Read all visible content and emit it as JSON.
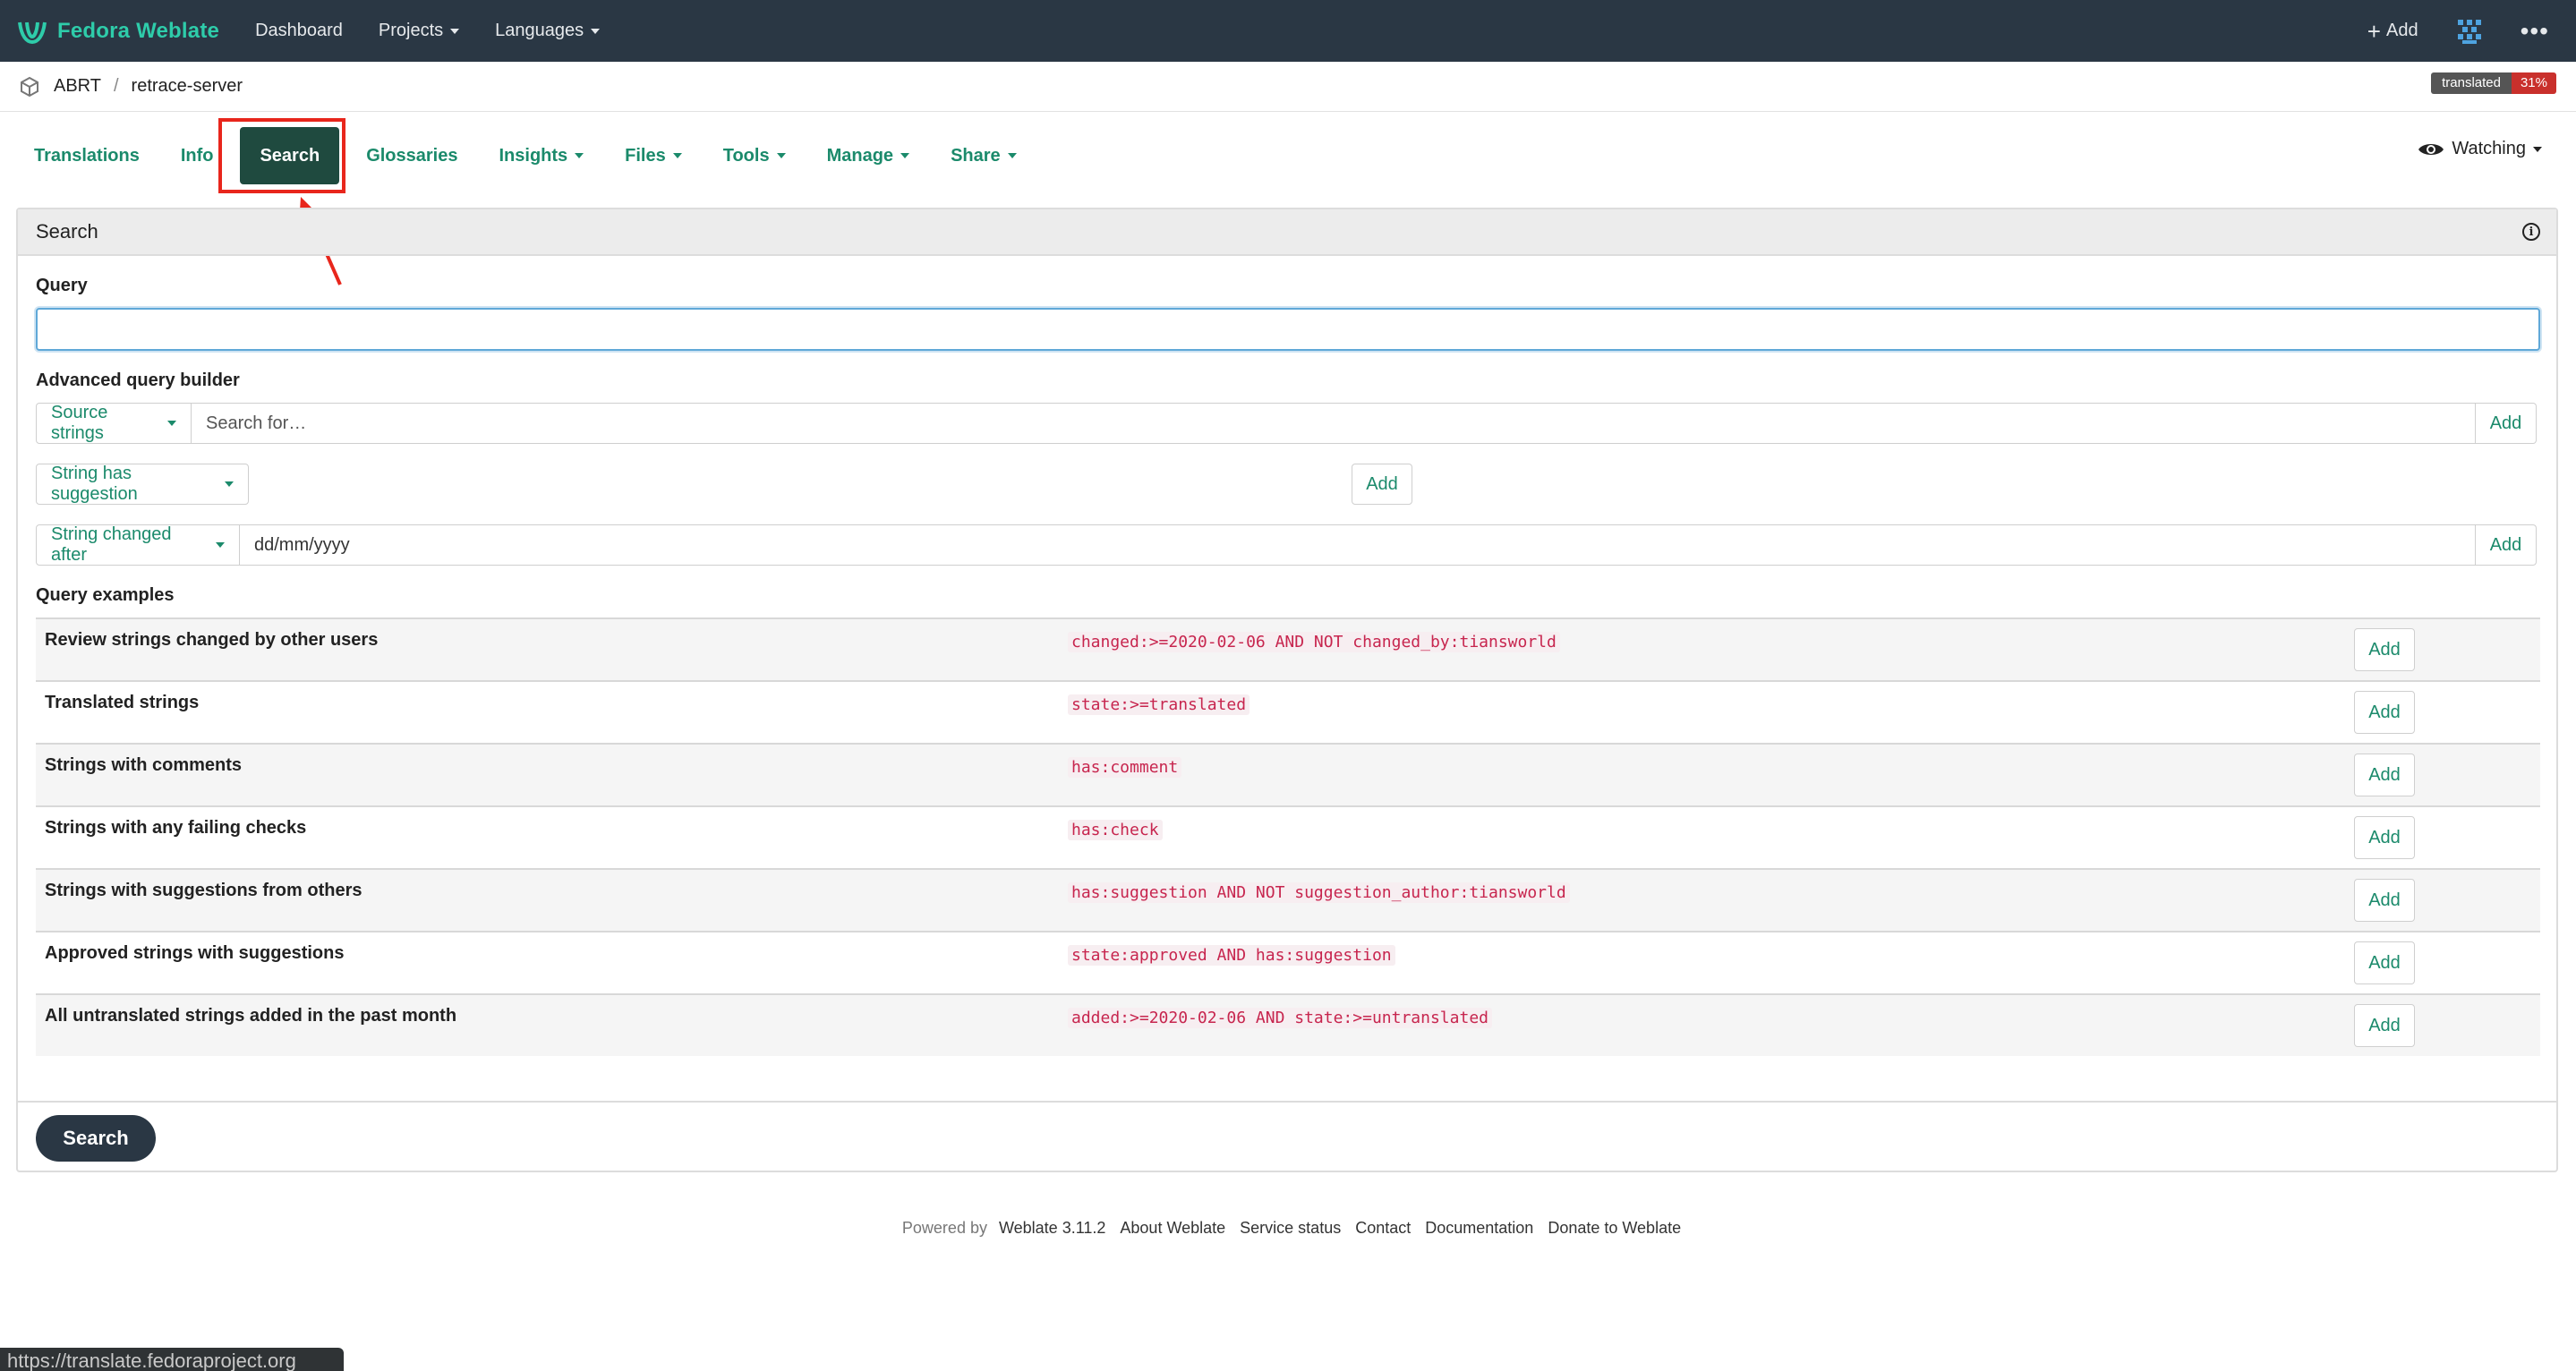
{
  "nav": {
    "brand": "Fedora Weblate",
    "items": [
      "Dashboard",
      "Projects",
      "Languages"
    ],
    "add_label": "Add"
  },
  "breadcrumb": {
    "project": "ABRT",
    "separator": "/",
    "component": "retrace-server",
    "badge_label": "translated",
    "badge_value": "31%"
  },
  "tabs": {
    "translations": "Translations",
    "info": "Info",
    "search": "Search",
    "glossaries": "Glossaries",
    "insights": "Insights",
    "files": "Files",
    "tools": "Tools",
    "manage": "Manage",
    "share": "Share"
  },
  "watching": "Watching",
  "panel": {
    "title": "Search",
    "query_label": "Query",
    "query_value": "",
    "builder_label": "Advanced query builder",
    "builder": {
      "row1_dropdown": "Source strings",
      "row1_placeholder": "Search for…",
      "row1_add": "Add",
      "row2_dropdown": "String has suggestion",
      "row2_add": "Add",
      "row3_dropdown": "String changed after",
      "row3_value": "dd/mm/yyyy",
      "row3_add": "Add"
    },
    "examples_label": "Query examples",
    "examples": [
      {
        "title": "Review strings changed by other users",
        "query": "changed:>=2020-02-06 AND NOT changed_by:tiansworld",
        "add": "Add"
      },
      {
        "title": "Translated strings",
        "query": "state:>=translated",
        "add": "Add"
      },
      {
        "title": "Strings with comments",
        "query": "has:comment",
        "add": "Add"
      },
      {
        "title": "Strings with any failing checks",
        "query": "has:check",
        "add": "Add"
      },
      {
        "title": "Strings with suggestions from others",
        "query": "has:suggestion AND NOT suggestion_author:tiansworld",
        "add": "Add"
      },
      {
        "title": "Approved strings with suggestions",
        "query": "state:approved AND has:suggestion",
        "add": "Add"
      },
      {
        "title": "All untranslated strings added in the past month",
        "query": "added:>=2020-02-06 AND state:>=untranslated",
        "add": "Add"
      }
    ],
    "submit": "Search"
  },
  "footer": {
    "powered_by": "Powered by",
    "weblate_version": "Weblate 3.11.2",
    "links": [
      "About Weblate",
      "Service status",
      "Contact",
      "Documentation",
      "Donate to Weblate"
    ]
  },
  "status_url": "https://translate.fedoraproject.org",
  "colors": {
    "navbar": "#2a3744",
    "brand": "#2eccaa",
    "accent_green": "#1b8a6b",
    "active_tab": "#1f4a3f",
    "annotation_red": "#e8261c",
    "code_red": "#c7254e"
  }
}
